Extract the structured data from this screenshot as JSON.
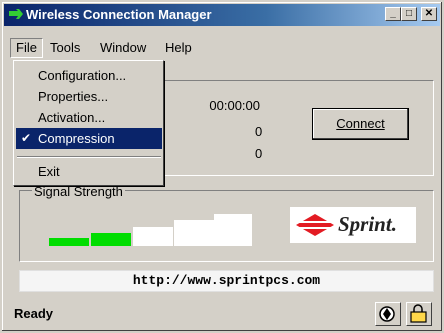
{
  "window": {
    "title": "Wireless Connection Manager",
    "buttons": {
      "minimize": "_",
      "maximize": "□",
      "close": "✕"
    }
  },
  "menubar": {
    "items": [
      "File",
      "Tools",
      "Window",
      "Help"
    ]
  },
  "file_menu": {
    "items": [
      "Configuration...",
      "Properties...",
      "Activation...",
      "Compression"
    ],
    "checked": "Compression",
    "exit": "Exit"
  },
  "connection": {
    "elapsed": "00:00:00",
    "sent": "0",
    "received": "0",
    "connect_label": "Connect"
  },
  "signal": {
    "label": "Signal Strength",
    "bars_total": 5,
    "bars_active": 2,
    "active_color": "#00dd00"
  },
  "brand": {
    "logo_text": "Sprint."
  },
  "url": "http://www.sprintpcs.com",
  "status": {
    "text": "Ready"
  }
}
